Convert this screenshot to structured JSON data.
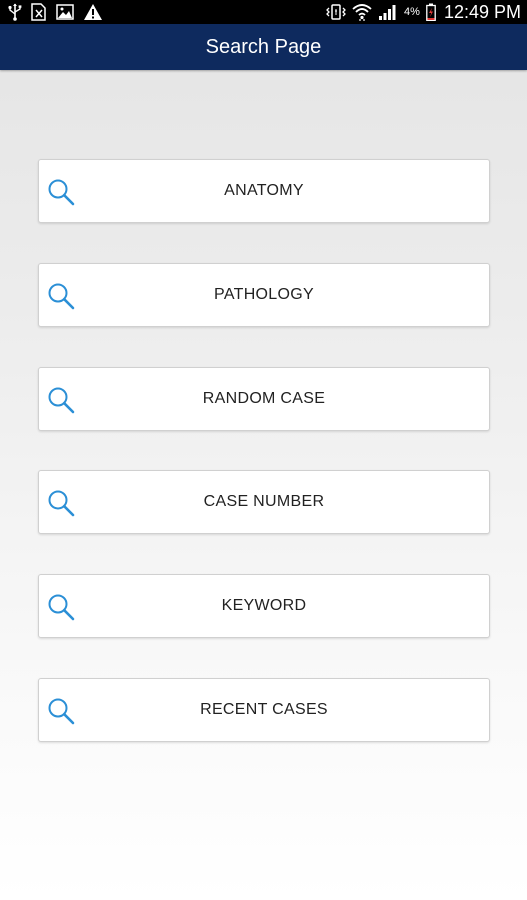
{
  "status_bar": {
    "left_icons": [
      "usb-icon",
      "no-sim-icon",
      "image-icon",
      "warning-icon"
    ],
    "right_icons": [
      "vibrate-icon",
      "wifi-icon",
      "signal-icon",
      "battery-icon"
    ],
    "battery_percent": "4%",
    "time": "12:49 PM"
  },
  "header": {
    "title": "Search Page",
    "background_color": "#0e2a5e"
  },
  "search_options": [
    {
      "label": "ANATOMY",
      "icon": "search-icon"
    },
    {
      "label": "PATHOLOGY",
      "icon": "search-icon"
    },
    {
      "label": "RANDOM CASE",
      "icon": "search-icon"
    },
    {
      "label": "CASE NUMBER",
      "icon": "search-icon"
    },
    {
      "label": "KEYWORD",
      "icon": "search-icon"
    },
    {
      "label": "RECENT CASES",
      "icon": "search-icon"
    }
  ],
  "colors": {
    "accent": "#2b8fd6",
    "text": "#222222"
  }
}
